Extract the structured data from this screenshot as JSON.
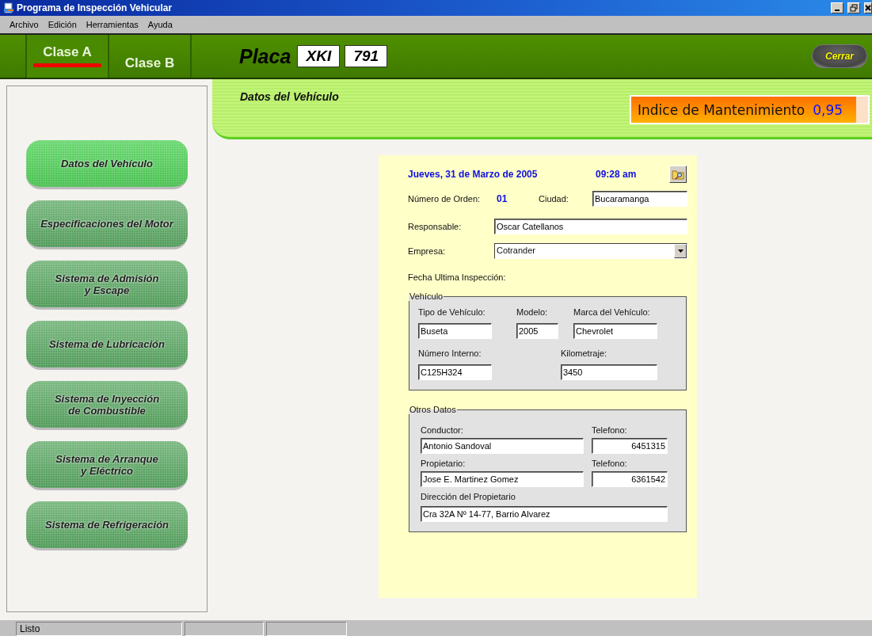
{
  "window": {
    "title": "Programa de Inspección Vehicular"
  },
  "menu": [
    "Archivo",
    "Edición",
    "Herramientas",
    "Ayuda"
  ],
  "tabs": [
    {
      "label": "Clase A",
      "selected": true
    },
    {
      "label": "Clase B",
      "selected": false
    }
  ],
  "plate": {
    "label": "Placa",
    "letters": "XKI",
    "numbers": "791"
  },
  "close_button": "Cerrar",
  "header": {
    "title": "Datos del Vehículo"
  },
  "index": {
    "label": "Indice de Mantenimiento",
    "value": "0,95",
    "level": 0.95
  },
  "sidebar": {
    "items": [
      {
        "label": "Datos del Vehículo",
        "selected": true
      },
      {
        "label": "Especificaciones del Motor",
        "selected": false
      },
      {
        "label": "Sistema de Admisión\ny Escape",
        "selected": false
      },
      {
        "label": "Sistema de Lubricación",
        "selected": false
      },
      {
        "label": "Sistema de Inyección\nde Combustible",
        "selected": false
      },
      {
        "label": "Sistema de Arranque\ny Eléctrico",
        "selected": false
      },
      {
        "label": "Sistema de Refrigeración",
        "selected": false
      }
    ]
  },
  "form": {
    "date": "Jueves, 31 de Marzo de 2005",
    "time": "09:28 am",
    "order_label": "Número de Orden:",
    "order_value": "01",
    "city_label": "Ciudad:",
    "city": "Bucaramanga",
    "responsible_label": "Responsable:",
    "responsible": "Oscar Catellanos",
    "company_label": "Empresa:",
    "company": "Cotrander",
    "last_inspection_label": "Fecha Ultima Inspección:",
    "vehicle": {
      "title": "Vehículo",
      "type_label": "Tipo de Vehículo:",
      "type": "Buseta",
      "model_label": "Modelo:",
      "model": "2005",
      "brand_label": "Marca del Vehículo:",
      "brand": "Chevrolet",
      "internal_label": "Número Interno:",
      "internal": "C125H324",
      "mileage_label": "Kilometraje:",
      "mileage": "3450"
    },
    "other": {
      "title": "Otros Datos",
      "driver_label": "Conductor:",
      "driver": "Antonio Sandoval",
      "driver_phone_label": "Telefono:",
      "driver_phone": "6451315",
      "owner_label": "Propietario:",
      "owner": "Jose E. Martinez Gomez",
      "owner_phone_label": "Telefono:",
      "owner_phone": "6361542",
      "address_label": "Dirección del Propietario",
      "address": "Cra 32A Nº 14-77, Barrio Alvarez"
    }
  },
  "status_bar": {
    "text": "Listo"
  }
}
